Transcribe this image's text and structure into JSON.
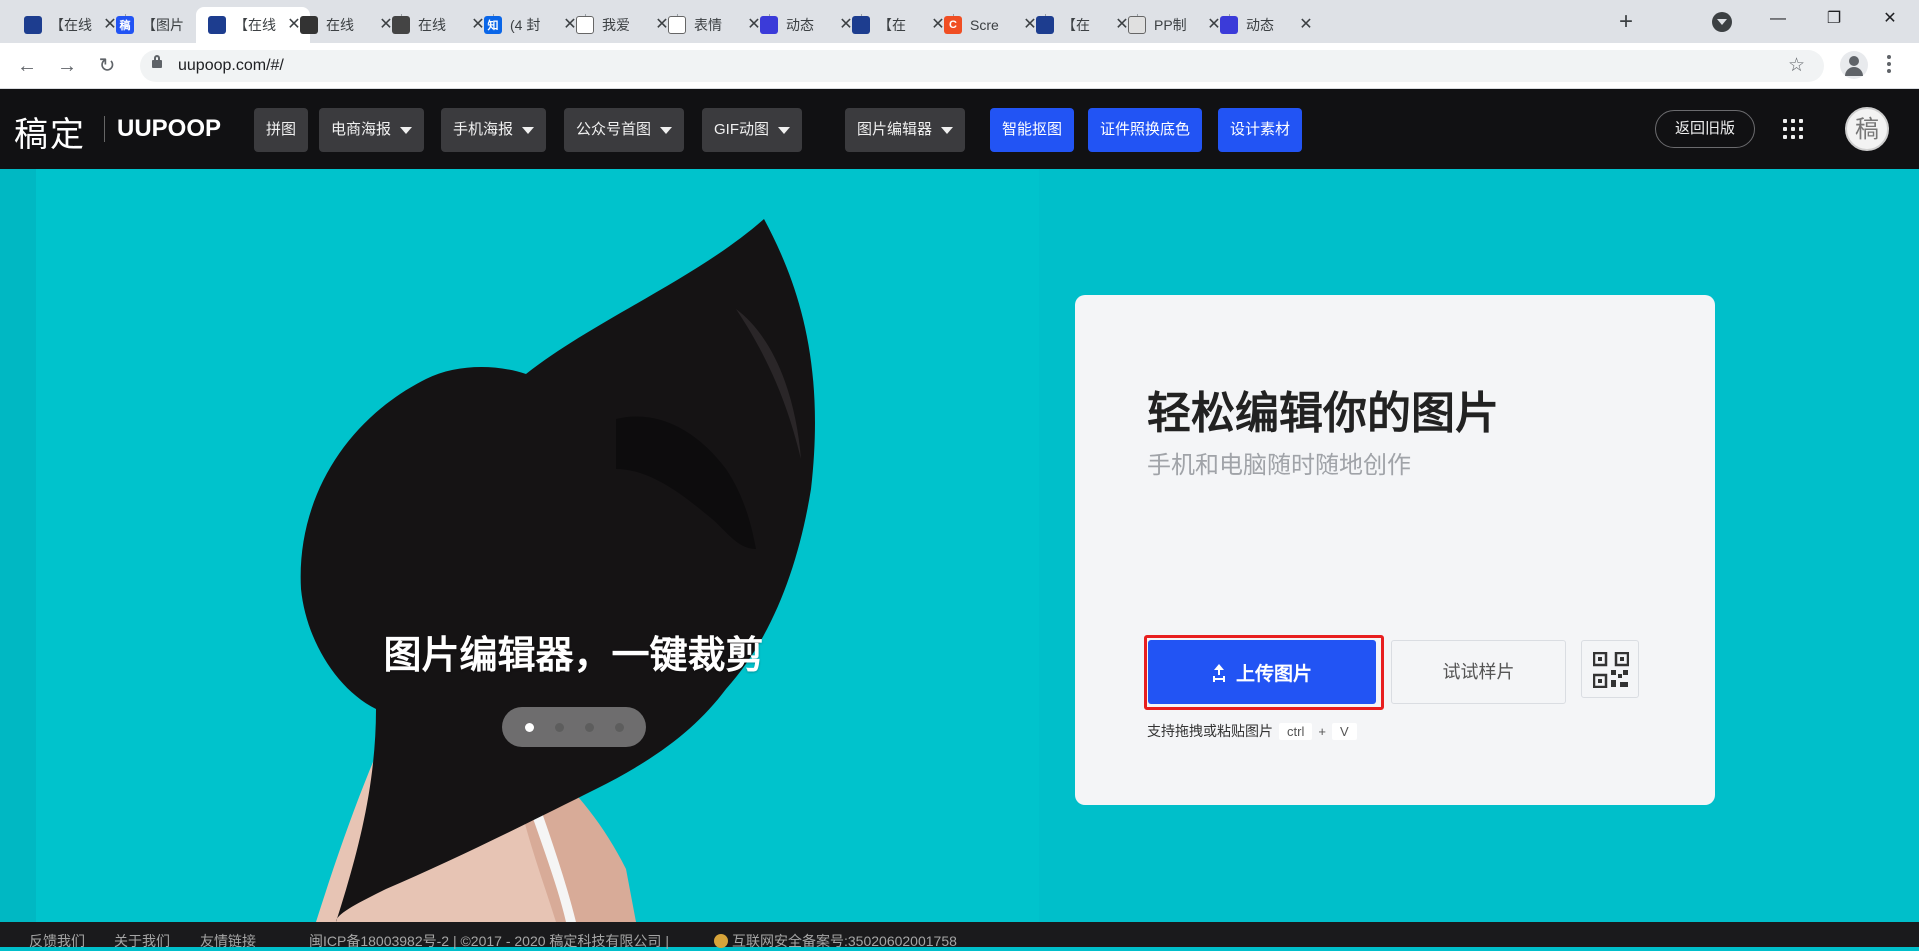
{
  "browser": {
    "tabs": [
      {
        "title": "【在线",
        "favicon": "uupoop-blue",
        "active": false
      },
      {
        "title": "【图片",
        "favicon": "gaoding-blue",
        "active": false
      },
      {
        "title": "【在线",
        "favicon": "uupoop-blue",
        "active": true
      },
      {
        "title": "在线",
        "favicon": "dark-logo",
        "active": false
      },
      {
        "title": "在线",
        "favicon": "circle-logo",
        "active": false
      },
      {
        "title": "(4 封",
        "favicon": "zhihu-blue",
        "active": false
      },
      {
        "title": "我爱",
        "favicon": "panda",
        "active": false
      },
      {
        "title": "表情",
        "favicon": "panda",
        "active": false
      },
      {
        "title": "动态",
        "favicon": "square-blue",
        "active": false
      },
      {
        "title": "【在",
        "favicon": "uupoop-blue",
        "active": false
      },
      {
        "title": "Scre",
        "favicon": "orange-c",
        "active": false
      },
      {
        "title": "【在",
        "favicon": "uupoop-blue",
        "active": false
      },
      {
        "title": "PP制",
        "favicon": "globe",
        "active": false
      },
      {
        "title": "动态",
        "favicon": "square-blue",
        "active": false
      }
    ],
    "url": "uupoop.com/#/",
    "tab_close": "✕",
    "new_tab": "+",
    "window": {
      "minimize": "—",
      "restore": "❐",
      "close": "✕"
    },
    "nav": {
      "back": "←",
      "forward": "→",
      "reload": "↻"
    },
    "star": "☆"
  },
  "header": {
    "logo_cn": "稿定",
    "logo_en": "UUPOOP",
    "nav": [
      {
        "label": "拼图",
        "dropdown": false,
        "highlight": false
      },
      {
        "label": "电商海报",
        "dropdown": true,
        "highlight": false
      },
      {
        "label": "手机海报",
        "dropdown": true,
        "highlight": false
      },
      {
        "label": "公众号首图",
        "dropdown": true,
        "highlight": false
      },
      {
        "label": "GIF动图",
        "dropdown": true,
        "highlight": false
      },
      {
        "label": "图片编辑器",
        "dropdown": true,
        "highlight": false
      },
      {
        "label": "智能抠图",
        "dropdown": false,
        "highlight": true
      },
      {
        "label": "证件照换底色",
        "dropdown": false,
        "highlight": true
      },
      {
        "label": "设计素材",
        "dropdown": false,
        "highlight": true
      }
    ],
    "old_version": "返回旧版",
    "avatar_text": "稿"
  },
  "hero": {
    "caption": "图片编辑器，一键裁剪",
    "slides_total": 4,
    "slide_active": 1,
    "card": {
      "title": "轻松编辑你的图片",
      "subtitle": "手机和电脑随时随地创作",
      "upload_label": "上传图片",
      "sample_label": "试试样片",
      "hint": "支持拖拽或粘贴图片",
      "key1": "ctrl",
      "plus": "+",
      "key2": "V"
    }
  },
  "footer": {
    "links": [
      "反馈我们",
      "关于我们",
      "友情链接"
    ],
    "legal": "闽ICP备18003982号-2 | ©2017 - 2020 稿定科技有限公司 |",
    "police": "互联网安全备案号:35020602001758"
  },
  "colors": {
    "hero_bg": "#00bfca",
    "header_bg": "#111113",
    "primary": "#2254f4",
    "highlight_border": "#e81f1f"
  }
}
